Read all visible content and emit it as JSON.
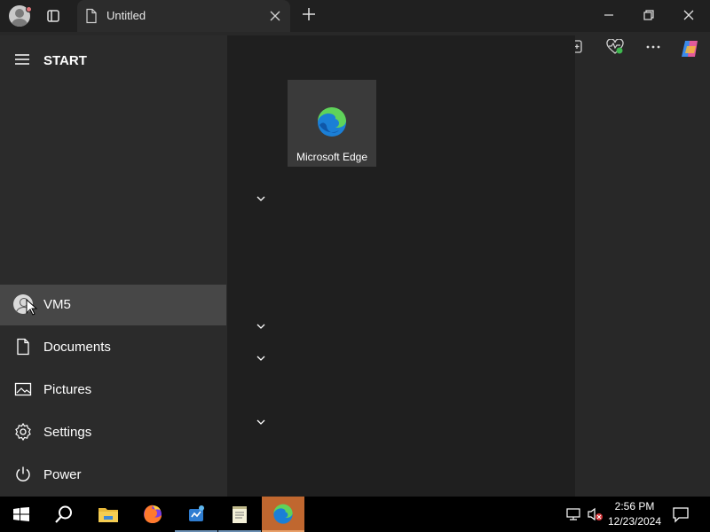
{
  "browser": {
    "tab_title": "Untitled"
  },
  "start_menu": {
    "title": "START",
    "user": "VM5",
    "items": [
      {
        "label": "Documents",
        "icon": "document-icon"
      },
      {
        "label": "Pictures",
        "icon": "pictures-icon"
      },
      {
        "label": "Settings",
        "icon": "gear-icon"
      },
      {
        "label": "Power",
        "icon": "power-icon"
      }
    ],
    "tiles": [
      {
        "label": "Microsoft Edge",
        "icon": "edge-icon"
      }
    ]
  },
  "taskbar": {
    "apps": [
      "file-explorer-icon",
      "firefox-icon",
      "task-manager-icon",
      "notepad-icon",
      "edge-icon"
    ],
    "clock_time": "2:56 PM",
    "clock_date": "12/23/2024"
  },
  "colors": {
    "focused_app": "#c0672f",
    "start_left": "#2b2b2b",
    "start_right": "#1f1f1f",
    "tile": "#3a3a3a"
  }
}
